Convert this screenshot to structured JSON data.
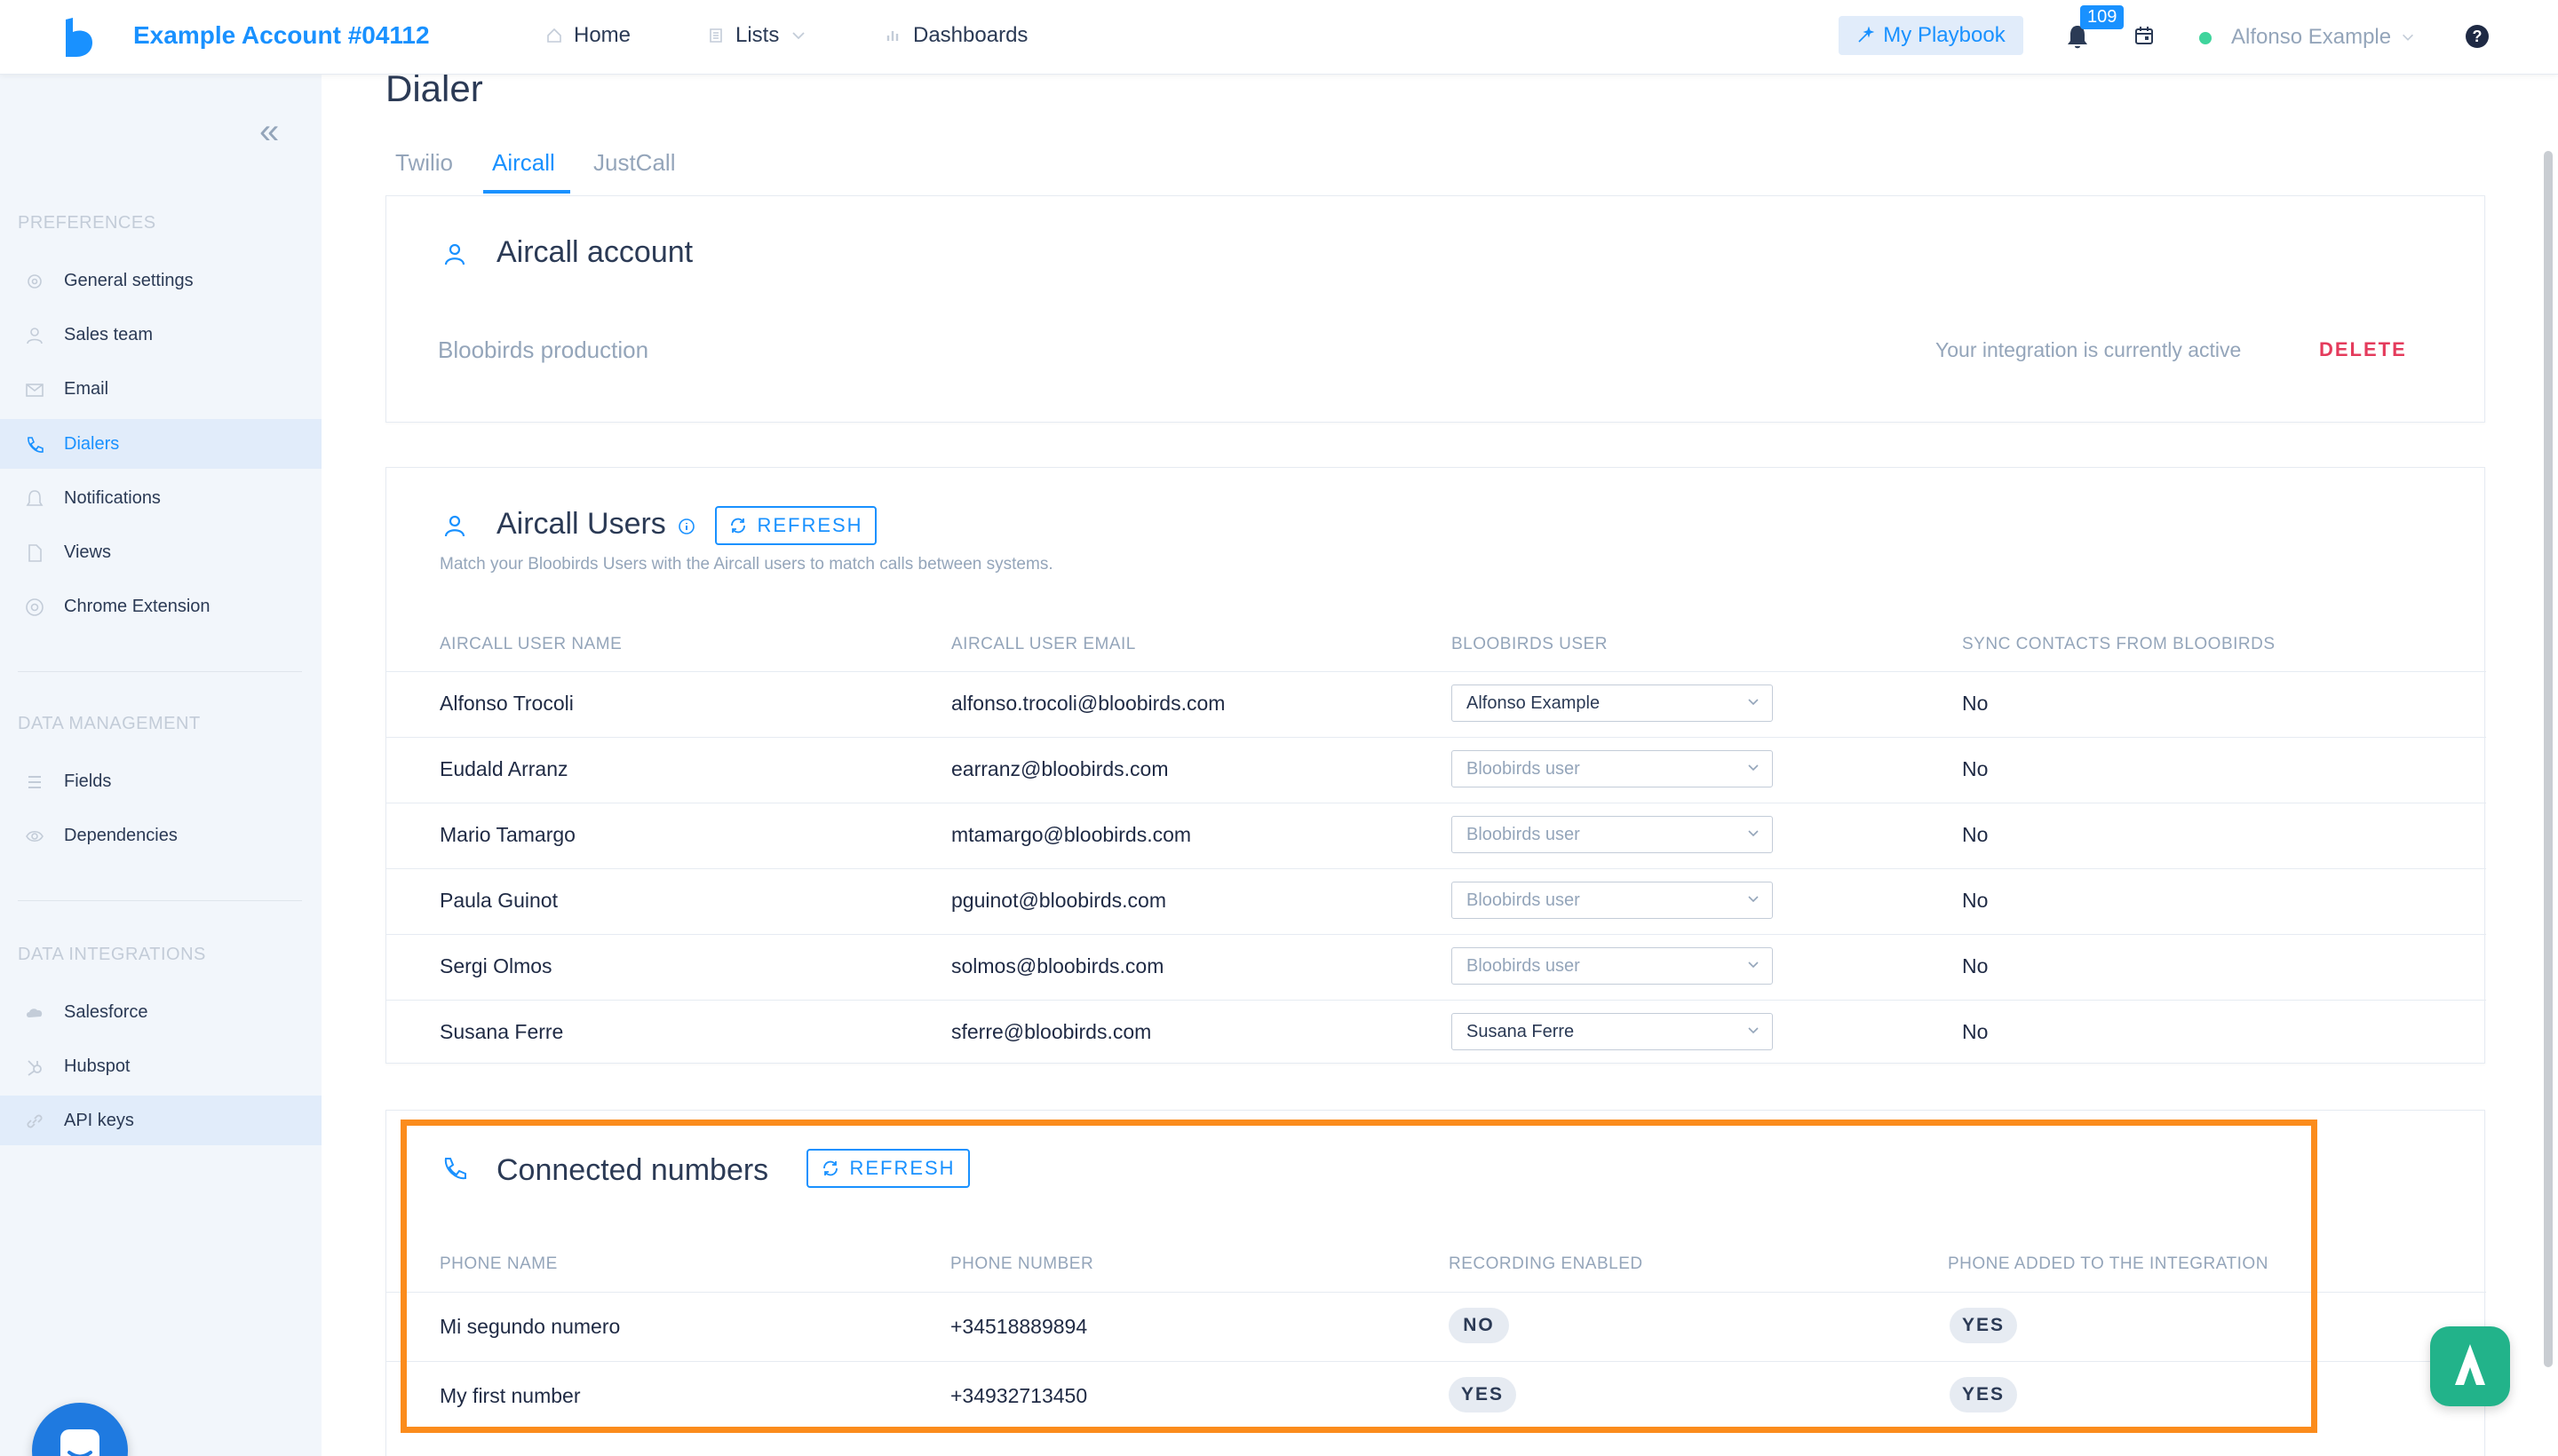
{
  "header": {
    "account_name": "Example Account #04112",
    "nav": {
      "home": "Home",
      "lists": "Lists",
      "dashboards": "Dashboards"
    },
    "playbook_label": "My Playbook",
    "notifications_count": "109",
    "user_name": "Alfonso Example",
    "help_glyph": "?",
    "status_color": "#3fd49c"
  },
  "sidebar": {
    "collapse_glyph": "«",
    "preferences_title": "PREFERENCES",
    "preferences": [
      {
        "label": "General settings",
        "icon": "gear-icon"
      },
      {
        "label": "Sales team",
        "icon": "user-icon"
      },
      {
        "label": "Email",
        "icon": "mail-icon"
      },
      {
        "label": "Dialers",
        "icon": "phone-icon",
        "active": true
      },
      {
        "label": "Notifications",
        "icon": "bell-icon"
      },
      {
        "label": "Views",
        "icon": "file-icon"
      },
      {
        "label": "Chrome Extension",
        "icon": "chrome-icon"
      }
    ],
    "data_management_title": "DATA MANAGEMENT",
    "data_management": [
      {
        "label": "Fields",
        "icon": "list-icon"
      },
      {
        "label": "Dependencies",
        "icon": "eye-icon"
      }
    ],
    "data_integrations_title": "DATA INTEGRATIONS",
    "data_integrations": [
      {
        "label": "Salesforce",
        "icon": "cloud-icon"
      },
      {
        "label": "Hubspot",
        "icon": "hubspot-icon"
      },
      {
        "label": "API keys",
        "icon": "link-icon"
      }
    ]
  },
  "page": {
    "title": "Dialer",
    "tabs": [
      "Twilio",
      "Aircall",
      "JustCall"
    ],
    "active_tab": "Aircall"
  },
  "account_card": {
    "title": "Aircall account",
    "account_name": "Bloobirds production",
    "status_text": "Your integration is currently active",
    "delete_label": "DELETE"
  },
  "users_card": {
    "title": "Aircall Users",
    "refresh_label": "REFRESH",
    "subtitle": "Match your Bloobirds Users with the Aircall users to match calls between systems.",
    "columns": [
      "AIRCALL USER NAME",
      "AIRCALL USER EMAIL",
      "BLOOBIRDS USER",
      "SYNC CONTACTS FROM BLOOBIRDS"
    ],
    "rows": [
      {
        "name": "Alfonso Trocoli",
        "email": "alfonso.trocoli@bloobirds.com",
        "bb_user": "Alfonso Example",
        "selected": true,
        "sync": "No"
      },
      {
        "name": "Eudald Arranz",
        "email": "earranz@bloobirds.com",
        "bb_user": "Bloobirds user",
        "selected": false,
        "sync": "No"
      },
      {
        "name": "Mario Tamargo",
        "email": "mtamargo@bloobirds.com",
        "bb_user": "Bloobirds user",
        "selected": false,
        "sync": "No"
      },
      {
        "name": "Paula Guinot",
        "email": "pguinot@bloobirds.com",
        "bb_user": "Bloobirds user",
        "selected": false,
        "sync": "No"
      },
      {
        "name": "Sergi Olmos",
        "email": "solmos@bloobirds.com",
        "bb_user": "Bloobirds user",
        "selected": false,
        "sync": "No"
      },
      {
        "name": "Susana Ferre",
        "email": "sferre@bloobirds.com",
        "bb_user": "Susana Ferre",
        "selected": true,
        "sync": "No"
      }
    ]
  },
  "numbers_card": {
    "title": "Connected numbers",
    "refresh_label": "REFRESH",
    "columns": [
      "PHONE NAME",
      "PHONE NUMBER",
      "RECORDING ENABLED",
      "PHONE ADDED TO THE INTEGRATION"
    ],
    "rows": [
      {
        "name": "Mi segundo numero",
        "number": "+34518889894",
        "recording": "NO",
        "added": "YES"
      },
      {
        "name": "My first number",
        "number": "+34932713450",
        "recording": "YES",
        "added": "YES"
      }
    ]
  },
  "colors": {
    "accent": "#1991ff",
    "danger": "#e43b5c",
    "highlight": "#fb8c1c",
    "sidebar_bg": "#f2f6fb"
  }
}
